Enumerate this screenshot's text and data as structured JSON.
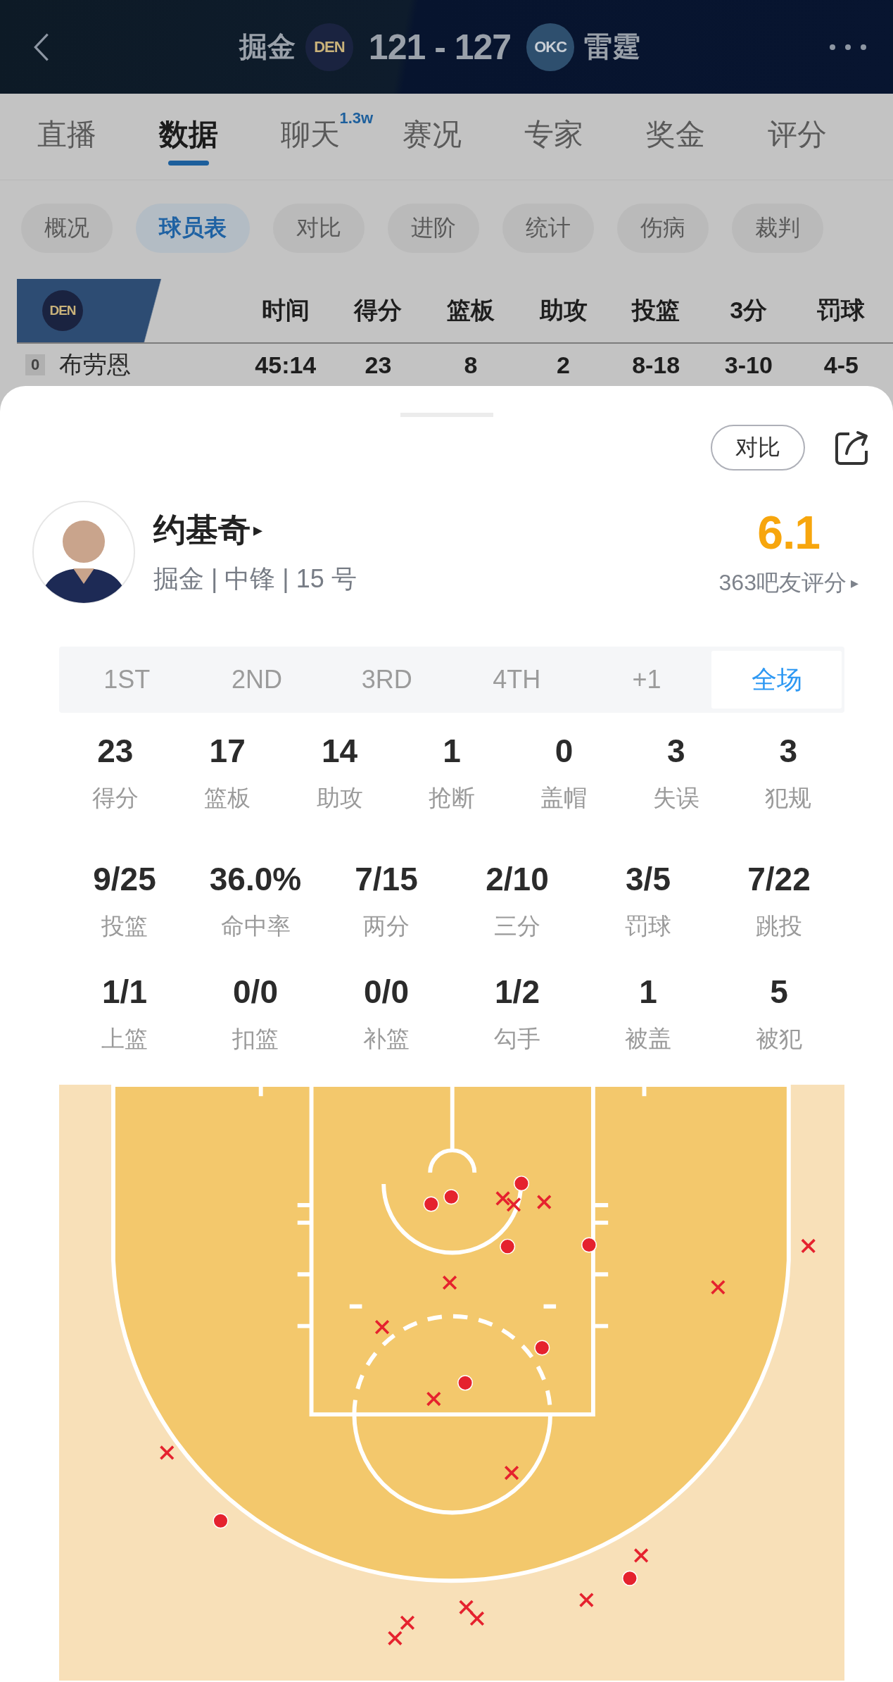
{
  "header": {
    "home": {
      "name": "掘金",
      "abbr": "DEN"
    },
    "score": "121 - 127",
    "away": {
      "name": "雷霆",
      "abbr": "OKC"
    }
  },
  "tabs": [
    {
      "label": "直播",
      "selected": false
    },
    {
      "label": "数据",
      "selected": true
    },
    {
      "label": "聊天",
      "selected": false,
      "badge": "1.3w"
    },
    {
      "label": "赛况",
      "selected": false
    },
    {
      "label": "专家",
      "selected": false
    },
    {
      "label": "奖金",
      "selected": false
    },
    {
      "label": "评分",
      "selected": false
    }
  ],
  "sub_tabs": [
    {
      "label": "概况",
      "selected": false
    },
    {
      "label": "球员表",
      "selected": true
    },
    {
      "label": "对比",
      "selected": false
    },
    {
      "label": "进阶",
      "selected": false
    },
    {
      "label": "统计",
      "selected": false
    },
    {
      "label": "伤病",
      "selected": false
    },
    {
      "label": "裁判",
      "selected": false
    }
  ],
  "box_score": {
    "team": "DEN",
    "columns": [
      "时间",
      "得分",
      "篮板",
      "助攻",
      "投篮",
      "3分",
      "罚球"
    ],
    "rows": [
      {
        "number": "0",
        "name": "布劳恩",
        "values": [
          "45:14",
          "23",
          "8",
          "2",
          "8-18",
          "3-10",
          "4-5"
        ]
      }
    ]
  },
  "player_card": {
    "compare_button": "对比",
    "name": "约基奇",
    "name_arrow": "▸",
    "info": "掘金 | 中锋 | 15 号",
    "rating": "6.1",
    "rating_count": "363吧友评分",
    "rating_arrow": "▸",
    "periods": [
      {
        "label": "1ST",
        "selected": false
      },
      {
        "label": "2ND",
        "selected": false
      },
      {
        "label": "3RD",
        "selected": false
      },
      {
        "label": "4TH",
        "selected": false
      },
      {
        "label": "+1",
        "selected": false
      },
      {
        "label": "全场",
        "selected": true
      }
    ],
    "stat_rows": [
      [
        {
          "value": "23",
          "label": "得分"
        },
        {
          "value": "17",
          "label": "篮板"
        },
        {
          "value": "14",
          "label": "助攻"
        },
        {
          "value": "1",
          "label": "抢断"
        },
        {
          "value": "0",
          "label": "盖帽"
        },
        {
          "value": "3",
          "label": "失误"
        },
        {
          "value": "3",
          "label": "犯规"
        }
      ],
      [
        {
          "value": "9/25",
          "label": "投篮"
        },
        {
          "value": "36.0%",
          "label": "命中率"
        },
        {
          "value": "7/15",
          "label": "两分"
        },
        {
          "value": "2/10",
          "label": "三分"
        },
        {
          "value": "3/5",
          "label": "罚球"
        },
        {
          "value": "7/22",
          "label": "跳投"
        }
      ],
      [
        {
          "value": "1/1",
          "label": "上篮"
        },
        {
          "value": "0/0",
          "label": "扣篮"
        },
        {
          "value": "0/0",
          "label": "补篮"
        },
        {
          "value": "1/2",
          "label": "勾手"
        },
        {
          "value": "1",
          "label": "被盖"
        },
        {
          "value": "5",
          "label": "被犯"
        }
      ]
    ],
    "shot_chart": {
      "shots": [
        {
          "made": true
        },
        {
          "made": true
        },
        {
          "made": true
        },
        {
          "made": true
        },
        {
          "made": true
        },
        {
          "made": true
        },
        {
          "made": true
        },
        {
          "made": true
        },
        {
          "made": true
        },
        {
          "made": false
        },
        {
          "made": false
        },
        {
          "made": false
        },
        {
          "made": false
        },
        {
          "made": false
        },
        {
          "made": false
        },
        {
          "made": false
        },
        {
          "made": false
        },
        {
          "made": false
        },
        {
          "made": false
        },
        {
          "made": false
        },
        {
          "made": false
        },
        {
          "made": false
        },
        {
          "made": false
        },
        {
          "made": false
        },
        {
          "made": false
        }
      ]
    }
  }
}
